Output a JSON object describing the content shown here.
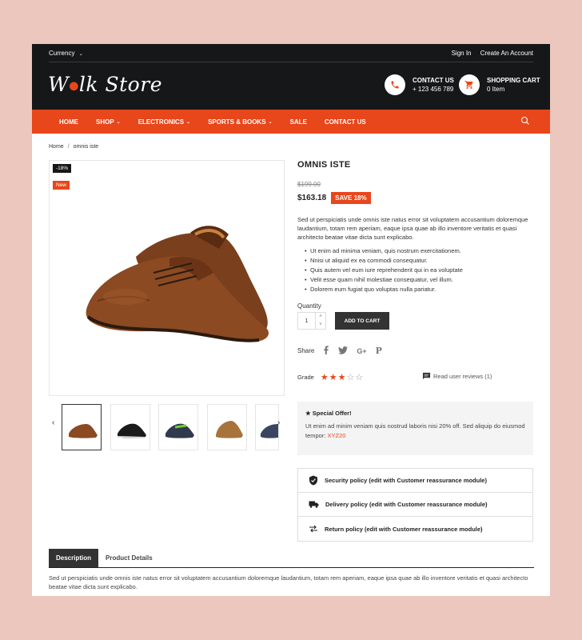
{
  "topbar": {
    "currency": "Currency",
    "sign_in": "Sign In",
    "create_account": "Create An Account"
  },
  "logo": {
    "text_w": "W",
    "text_rest": "lk Store"
  },
  "contact": {
    "title": "CONTACT US",
    "phone": "+ 123 456 789"
  },
  "cart": {
    "title": "SHOPPING CART",
    "count": "0 Item"
  },
  "nav": {
    "items": [
      {
        "label": "HOME",
        "dropdown": false
      },
      {
        "label": "SHOP",
        "dropdown": true
      },
      {
        "label": "ELECTRONICS",
        "dropdown": true
      },
      {
        "label": "SPORTS & BOOKS",
        "dropdown": true
      },
      {
        "label": "SALE",
        "dropdown": false
      },
      {
        "label": "CONTACT US",
        "dropdown": false
      }
    ]
  },
  "breadcrumb": {
    "home": "Home",
    "current": "omnis iste"
  },
  "product": {
    "badge_discount": "-18%",
    "badge_new": "New",
    "name": "OMNIS ISTE",
    "old_price": "$199.00",
    "price": "$163.18",
    "save": "SAVE 18%",
    "description": "Sed ut perspiciatis unde omnis iste natus error sit voluptatem accusantium doloremque laudantium, totam rem aperiam, eaque ipsa quae ab illo inventore veritatis et quasi architecto beatae vitae dicta sunt explicabo.",
    "bullets": [
      "Ut enim ad minima veniam, quis nostrum exercitationem.",
      "Nnisi ut aliquid ex ea commodi consequatur.",
      "Quis autem vel eum iure reprehenderit qui in ea voluptate",
      "Velit esse quam nihil molestiae consequatur, vel illum.",
      "Dolorem eum fugiat quo voluptas nulla pariatur."
    ],
    "quantity_label": "Quantity",
    "quantity_value": "1",
    "add_to_cart": "ADD TO CART",
    "share_label": "Share",
    "grade_label": "Grade",
    "rating": 3,
    "rating_max": 5,
    "reviews": "Read user reviews (1)"
  },
  "offer": {
    "title": "★ Special Offer!",
    "body": "Ut enim ad minim veniam quis nostrud laboris nisi 20% off. Sed aliquip do eiusmod tempor: ",
    "code": "XYZ20"
  },
  "policies": [
    "Security policy (edit with Customer reassurance module)",
    "Delivery policy (edit with Customer reassurance module)",
    "Return policy (edit with Customer reassurance module)"
  ],
  "tabs": {
    "description": "Description",
    "details": "Product Details",
    "text": "Sed ut perspiciatis unde omnis iste natus error sit voluptatem accusantium doloremque laudantium, totam rem aperiam, eaque ipsa quae ab illo inventore veritatis et quasi architecto beatae vitae dicta sunt explicabo."
  },
  "colors": {
    "accent": "#e8461b",
    "dark": "#161718",
    "background": "#ebc7bd"
  }
}
